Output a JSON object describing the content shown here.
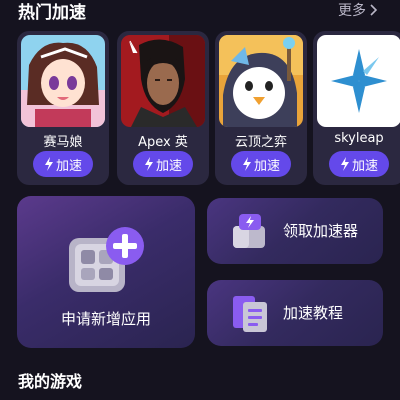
{
  "hot": {
    "title": "热门加速",
    "more_label": "更多"
  },
  "games": [
    {
      "name": "赛马娘",
      "button_label": "加速"
    },
    {
      "name": "Apex 英",
      "button_label": "加速"
    },
    {
      "name": "云顶之弈",
      "button_label": "加速"
    },
    {
      "name": "skyleap",
      "button_label": "加速"
    }
  ],
  "tiles": {
    "add_app": "申请新增应用",
    "get_accelerator": "领取加速器",
    "tutorial": "加速教程"
  },
  "my_games": {
    "title": "我的游戏"
  },
  "colors": {
    "background": "#15131f",
    "card": "#2b2840",
    "accent": "#6449ea"
  }
}
